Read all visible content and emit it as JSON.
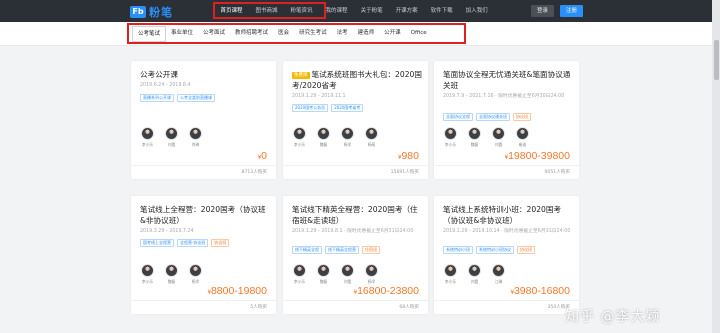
{
  "brand": {
    "logo_mark": "Fb",
    "name": "粉笔",
    "accent": "#2a8ff7"
  },
  "nav": {
    "items": [
      "首页课程",
      "图书商城",
      "粉笔资讯",
      "我的课程",
      "关于粉笔",
      "开课方案",
      "软件下载",
      "加入我们"
    ],
    "active_index": 0,
    "login": "登录",
    "register": "注册"
  },
  "categories": {
    "items": [
      "公考笔试",
      "事业单位",
      "公考面试",
      "教师招聘考试",
      "医会",
      "研究生考试",
      "法考",
      "建造师",
      "公开课",
      "Office"
    ],
    "active_index": 0
  },
  "cards": [
    {
      "title": "公考公开课",
      "date": "2019.6.24 - 2019.8.4",
      "badges": [
        {
          "text": "直播系列公开课",
          "style": "blue"
        },
        {
          "text": "公考全类别直播课",
          "style": "blue"
        }
      ],
      "teachers": [
        "李小乐",
        "刘霞",
        "徐琦"
      ],
      "price": "0",
      "enrolled": "8713人购买"
    },
    {
      "tag": "免费课",
      "title": "笔试系统班图书大礼包：2020国考/2020省考",
      "date": "2019.1.29 - 2019.11.1",
      "badges": [
        {
          "text": "2020国考公务员",
          "style": "blue"
        },
        {
          "text": "2020国考省考",
          "style": "blue"
        }
      ],
      "teachers": [
        "李小乐",
        "魏磊",
        "杨学",
        "杨萌"
      ],
      "price": "980",
      "enrolled": "15691人购买"
    },
    {
      "title": "笔面协议全程无忧通关班&笔面协议通关班",
      "date": "2019.7.9 - 2021.7.16 · 限时优惠截止至6月30日24:00",
      "badges": [
        {
          "text": "全面协议全程",
          "style": "blue"
        },
        {
          "text": "全面协议通关班",
          "style": "blue"
        },
        {
          "text": "协议班",
          "style": "orange"
        }
      ],
      "teachers": [
        "李小乐",
        "魏磊",
        "刘霞",
        "崔琰"
      ],
      "price": "19800-39800",
      "enrolled": "9051人购买"
    },
    {
      "title": "笔试线上全程营：2020国考（协议班&非协议班）",
      "date": "2019.3.29 - 2019.7.24",
      "badges": [
        {
          "text": "国考线上全程营",
          "style": "blue"
        },
        {
          "text": "全程营·协议班",
          "style": "blue"
        },
        {
          "text": "协议班",
          "style": "orange"
        }
      ],
      "teachers": [
        "李小乐",
        "魏磊",
        "杨学"
      ],
      "price": "8800-19800",
      "enrolled": "5人购买"
    },
    {
      "title": "笔试线下精英全程营：2020国考（住宿班&走读班）",
      "date": "2019.1.29 - 2019.8.1 · 限时优惠截止至6月31日24:00",
      "badges": [
        {
          "text": "线下精英全程",
          "style": "blue"
        },
        {
          "text": "线下精英全程营",
          "style": "blue"
        },
        {
          "text": "住宿班",
          "style": "orange"
        }
      ],
      "teachers": [
        "李小乐",
        "魏磊",
        "刘霞",
        "杨学"
      ],
      "price": "16800-23800",
      "enrolled": "68人购买"
    },
    {
      "title": "笔试线上系统特训小班：2020国考（协议班&非协议班）",
      "date": "2019.1.29 - 2019.10.14 · 限时优惠截止至6月31日24:00",
      "badges": [
        {
          "text": "系统特训小班",
          "style": "blue"
        },
        {
          "text": "系统特训小班协议",
          "style": "blue"
        },
        {
          "text": "协议班",
          "style": "orange"
        }
      ],
      "teachers": [
        "李小乐",
        "刘霞",
        "江琳"
      ],
      "price": "3980-16800",
      "enrolled": "354人购买"
    }
  ],
  "currency": "¥",
  "watermark": "知乎 @李大颖",
  "colors": {
    "price": "#f5782a",
    "highlight_box": "#e02020",
    "nav_bg": "#2b2f36"
  }
}
